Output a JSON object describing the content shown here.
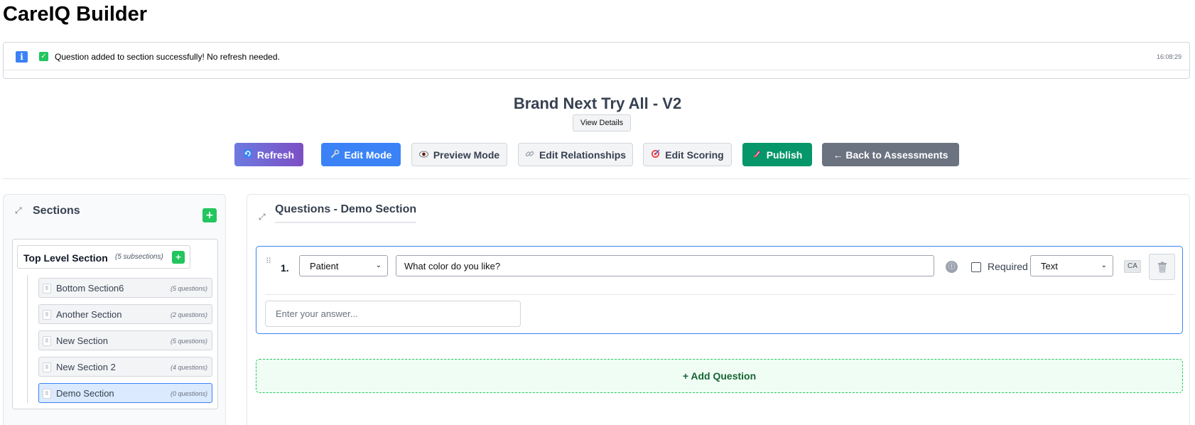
{
  "app": {
    "title": "CareIQ Builder"
  },
  "notification": {
    "info_icon": "i",
    "check_icon": "✓",
    "message": "Question added to section successfully! No refresh needed.",
    "time": "16:08:29"
  },
  "assessment": {
    "title": "Brand Next Try All - V2",
    "view_details_label": "View Details"
  },
  "toolbar": {
    "refresh_label": "Refresh",
    "edit_mode_label": "Edit Mode",
    "preview_mode_label": "Preview Mode",
    "edit_relationships_label": "Edit Relationships",
    "edit_scoring_label": "Edit Scoring",
    "publish_label": "Publish",
    "back_label": "← Back to Assessments",
    "icons": {
      "refresh": "refresh-icon",
      "edit_mode": "wrench-icon",
      "preview_mode": "eye-icon",
      "edit_relationships": "link-icon",
      "edit_scoring": "target-icon",
      "publish": "rocket-icon"
    },
    "colors": {
      "edit_mode": "#3b82f6",
      "publish": "#059669",
      "back": "#6b7280"
    }
  },
  "sections": {
    "title": "Sections",
    "add_label": "+",
    "top_level": {
      "label": "Top Level Section",
      "subsections_text": "(5 subsections)",
      "add_label": "+"
    },
    "items": [
      {
        "label": "Bottom Section6",
        "count": "(5 questions)"
      },
      {
        "label": "Another Section",
        "count": "(2 questions)"
      },
      {
        "label": "New Section",
        "count": "(5 questions)"
      },
      {
        "label": "New Section 2",
        "count": "(4 questions)"
      },
      {
        "label": "Demo Section",
        "count": "(0 questions)",
        "active": true
      }
    ]
  },
  "questions": {
    "title": "Questions - Demo Section",
    "items": [
      {
        "number": "1.",
        "voice": "Patient",
        "text": "What color do you like?",
        "required_label": "Required",
        "required": false,
        "type": "Text",
        "ca_label": "CA",
        "answer_placeholder": "Enter your answer..."
      }
    ],
    "add_question_label": "+ Add Question"
  }
}
